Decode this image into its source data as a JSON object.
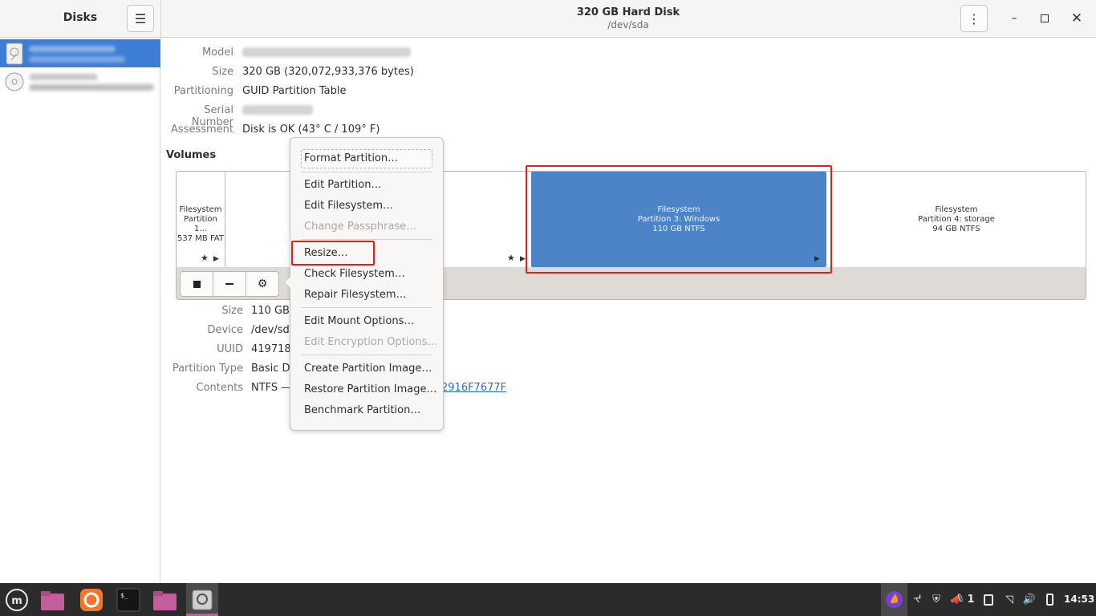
{
  "app": {
    "title": "Disks",
    "menu_icon": "hamburger-icon"
  },
  "window": {
    "title": "320 GB Hard Disk",
    "subtitle": "/dev/sda",
    "controls": [
      "kebab-menu-icon",
      "minimize-icon",
      "maximize-icon",
      "close-icon"
    ]
  },
  "sidebar": {
    "drives": [
      {
        "icon": "hard-disk-icon",
        "name": "320 GB Hard Disk",
        "detail": "Redacted",
        "selected": true
      },
      {
        "icon": "optical-drive-icon",
        "name": "CD/DVD Drive",
        "detail": "Redacted",
        "selected": false
      }
    ]
  },
  "disk_info": {
    "model_label": "Model",
    "size_label": "Size",
    "size_value": "320 GB (320,072,933,376 bytes)",
    "partitioning_label": "Partitioning",
    "partitioning_value": "GUID Partition Table",
    "serial_label": "Serial Number",
    "assessment_label": "Assessment",
    "assessment_value": "Disk is OK (43° C / 109° F)"
  },
  "volumes": {
    "title": "Volumes",
    "partitions": [
      {
        "line1": "Filesystem",
        "line2": "Partition 1...",
        "line3": "537 MB FAT"
      },
      {
        "line1": "",
        "line2": "",
        "line3": ""
      },
      {
        "line1": "Filesystem",
        "line2": "Partition 3: Windows",
        "line3": "110 GB NTFS"
      },
      {
        "line1": "Filesystem",
        "line2": "Partition 4: storage",
        "line3": "94 GB NTFS"
      }
    ],
    "toolbar": {
      "stop_icon": "stop-icon",
      "remove_icon": "minus-icon",
      "settings_icon": "gears-icon"
    }
  },
  "partition_info": {
    "size_label": "Size",
    "size_value": "110 GB",
    "device_label": "Device",
    "device_value": "/dev/sda",
    "uuid_label": "UUID",
    "uuid_value": "419718",
    "type_label": "Partition Type",
    "type_value": "Basic Da",
    "contents_label": "Contents",
    "contents_value": "NTFS —",
    "contents_link": "2916F7677F"
  },
  "popover_menu": {
    "items": [
      {
        "label": "Format Partition…",
        "enabled": true
      },
      {
        "label": "Edit Partition…",
        "enabled": true
      },
      {
        "label": "Edit Filesystem…",
        "enabled": true
      },
      {
        "label": "Change Passphrase…",
        "enabled": false
      },
      {
        "label": "Resize…",
        "enabled": true
      },
      {
        "label": "Check Filesystem…",
        "enabled": true
      },
      {
        "label": "Repair Filesystem…",
        "enabled": true
      },
      {
        "label": "Edit Mount Options…",
        "enabled": true
      },
      {
        "label": "Edit Encryption Options…",
        "enabled": false
      },
      {
        "label": "Create Partition Image…",
        "enabled": true
      },
      {
        "label": "Restore Partition Image…",
        "enabled": true
      },
      {
        "label": "Benchmark Partition…",
        "enabled": true
      }
    ]
  },
  "taskbar": {
    "apps": [
      "mint-menu-icon",
      "files-icon",
      "firefox-icon",
      "terminal-icon",
      "folder-icon",
      "disks-icon"
    ],
    "tray": [
      "firefox-tray-icon",
      "bluetooth-icon",
      "shield-icon",
      "notifications-icon",
      "workspace-icon",
      "wifi-icon",
      "volume-icon",
      "battery-icon"
    ],
    "notification_count": "1",
    "clock": "14:53"
  },
  "colors": {
    "selection": "#3d7dd5",
    "highlight_box": "#e02020",
    "taskbar": "#2b2b2b"
  }
}
